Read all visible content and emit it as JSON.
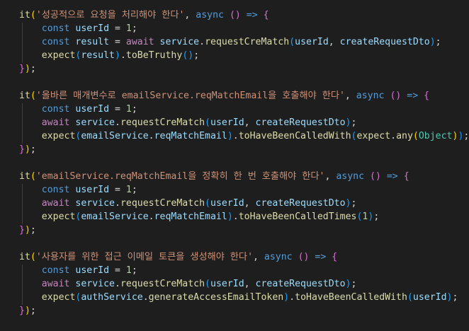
{
  "editor": {
    "background": "#1e1e1e",
    "blocks": [
      {
        "title": "'성공적으로 요청을 처리해야 한다'",
        "line1": {
          "kw": "const",
          "var": "userId",
          "num": "1"
        },
        "line2": {
          "kw": "const",
          "var": "result",
          "await": "await",
          "obj": "service",
          "fn": "requestCreMatch",
          "a1": "userId",
          "a2": "createRequestDto"
        },
        "line3": {
          "fn1": "expect",
          "arg": "result",
          "fn2": "toBeTruthy"
        }
      },
      {
        "title": "'올바른 매개변수로 emailService.reqMatchEmail을 호출해야 한다'",
        "line1": {
          "kw": "const",
          "var": "userId",
          "num": "1"
        },
        "line2": {
          "await": "await",
          "obj": "service",
          "fn": "requestCreMatch",
          "a1": "userId",
          "a2": "createRequestDto"
        },
        "line3": {
          "fn1": "expect",
          "obj": "emailService",
          "prop": "reqMatchEmail",
          "fn2": "toHaveBeenCalledWith",
          "fn3": "expect",
          "fn4": "any",
          "cls": "Object"
        }
      },
      {
        "title": "'emailService.reqMatchEmail을 정확히 한 번 호출해야 한다'",
        "line1": {
          "kw": "const",
          "var": "userId",
          "num": "1"
        },
        "line2": {
          "await": "await",
          "obj": "service",
          "fn": "requestCreMatch",
          "a1": "userId",
          "a2": "createRequestDto"
        },
        "line3": {
          "fn1": "expect",
          "obj": "emailService",
          "prop": "reqMatchEmail",
          "fn2": "toHaveBeenCalledTimes",
          "num": "1"
        }
      },
      {
        "title": "'사용자를 위한 접근 이메일 토큰을 생성해야 한다'",
        "line1": {
          "kw": "const",
          "var": "userId",
          "num": "1"
        },
        "line2": {
          "await": "await",
          "obj": "service",
          "fn": "requestCreMatch",
          "a1": "userId",
          "a2": "createRequestDto"
        },
        "line3": {
          "fn1": "expect",
          "obj": "authService",
          "prop": "generateAccessEmailToken",
          "fn2": "toHaveBeenCalledWith",
          "arg": "userId"
        }
      }
    ],
    "common": {
      "it": "it",
      "async": "async"
    }
  }
}
